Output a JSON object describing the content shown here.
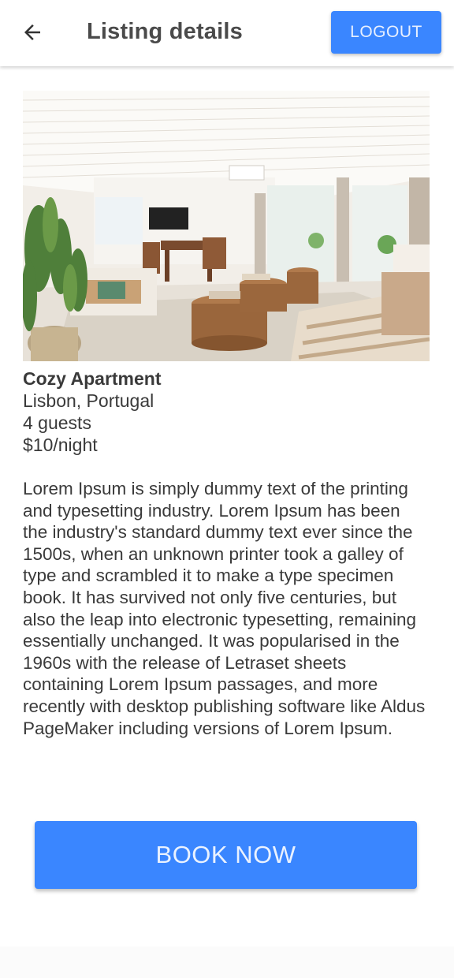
{
  "header": {
    "back_icon": "arrow-left-icon",
    "title": "Listing details",
    "logout_label": "LOGOUT",
    "accent_color": "#3a86ff"
  },
  "listing": {
    "photo_description_icon": "room-photo",
    "name": "Cozy Apartment",
    "location": "Lisbon, Portugal",
    "guests": "4 guests",
    "price": "$10/night",
    "description": "Lorem Ipsum is simply dummy text of the printing and typesetting industry. Lorem Ipsum has been the industry's standard dummy text ever since the 1500s, when an unknown printer took a galley of type and scrambled it to make a type specimen book. It has survived not only five centuries, but also the leap into electronic typesetting, remaining essentially unchanged. It was popularised in the 1960s with the release of Letraset sheets containing Lorem Ipsum passages, and more recently with desktop publishing software like Aldus PageMaker including versions of Lorem Ipsum."
  },
  "actions": {
    "book_label": "BOOK NOW"
  }
}
